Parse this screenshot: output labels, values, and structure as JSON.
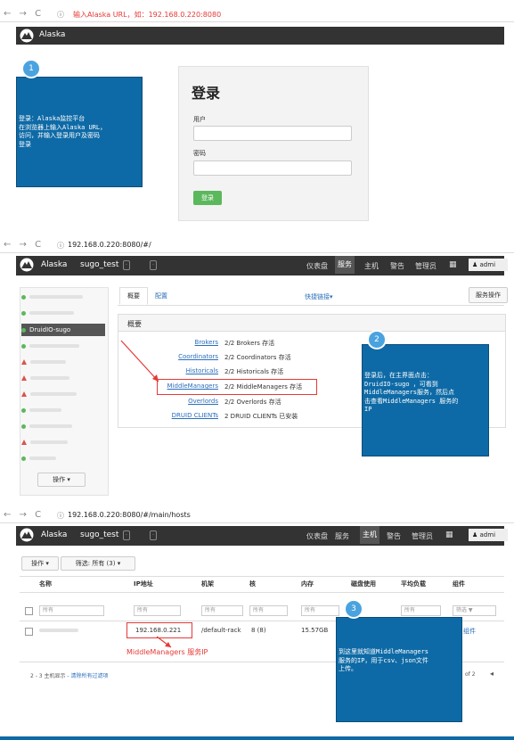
{
  "section1": {
    "url_hint": "输入Alaska URL，如：192.168.0.220:8080",
    "brand": "Alaska",
    "callout": {
      "number": "1",
      "lines": [
        "登录：Alaska监控平台",
        "在浏览器上输入Alaska URL，",
        "访问，并输入登录用户及密码",
        "登录"
      ]
    },
    "login": {
      "title": "登录",
      "user_label": "用户",
      "password_label": "密码",
      "submit": "登录"
    }
  },
  "section2": {
    "url": "192.168.0.220:8080/#/",
    "brand": "Alaska",
    "product": "sugo_test",
    "nav": [
      "仪表盘",
      "服务",
      "主机",
      "警告",
      "管理员"
    ],
    "active_nav": "服务",
    "user": "admi",
    "sidebar_selected": "DruidIO-sugo",
    "tabs": [
      "概要",
      "配置"
    ],
    "quick_links": "快捷链接",
    "service_actions": "服务操作",
    "summary_title": "概要",
    "services": [
      {
        "name": "Brokers",
        "status": "2/2 Brokers 存活"
      },
      {
        "name": "Coordinators",
        "status": "2/2 Coordinators 存活"
      },
      {
        "name": "Historicals",
        "status": "2/2 Historicals 存活"
      },
      {
        "name": "MiddleManagers",
        "status": "2/2 MiddleManagers 存活"
      },
      {
        "name": "Overlords",
        "status": "2/2 Overlords 存活"
      },
      {
        "name": "DRUID CLIENTs",
        "status": "2 DRUID CLIENTs 已安装"
      }
    ],
    "actions_button": "操作",
    "callout": {
      "number": "2",
      "lines": [
        "登录后，在主界面点击：",
        "DruidIO-sugo ，可看到",
        "MiddleManagers服务，然后点",
        "击查看MiddleManagers 服务的",
        "IP"
      ]
    }
  },
  "section3": {
    "url": "192.168.0.220:8080/#/main/hosts",
    "brand": "Alaska",
    "product": "sugo_test",
    "nav": [
      "仪表盘",
      "服务",
      "主机",
      "警告",
      "管理员"
    ],
    "active_nav": "主机",
    "user": "admi",
    "actions_button": "操作",
    "filter_button": "筛选: 所有 (3)",
    "columns": [
      "名称",
      "IP地址",
      "机架",
      "核",
      "内存",
      "磁盘使用",
      "平均负载",
      "组件"
    ],
    "filter_placeholder": "所有",
    "filter_right": "筛选",
    "row": {
      "ip": "192.168.0.221",
      "rack": "/default-rack",
      "cores": "8 (8)",
      "memory": "15.57GB",
      "component": "组件"
    },
    "ip_annotation": "MiddleManagers 服务IP",
    "footer_text": "2 - 3 主机显示 - ",
    "footer_link": "清除所有过滤项",
    "footer_page": "of 2",
    "callout": {
      "number": "3",
      "lines": [
        "到这里就知道MiddleManagers",
        "服务的IP，用于csv、json文件",
        "上传。"
      ]
    }
  },
  "colors": {
    "callout_blue": "#0e6aa6",
    "badge_blue": "#4aa3df",
    "topbar": "#333333",
    "login_green": "#5cb85c",
    "annotation_red": "#e53935",
    "link_blue": "#2a6ebb"
  }
}
